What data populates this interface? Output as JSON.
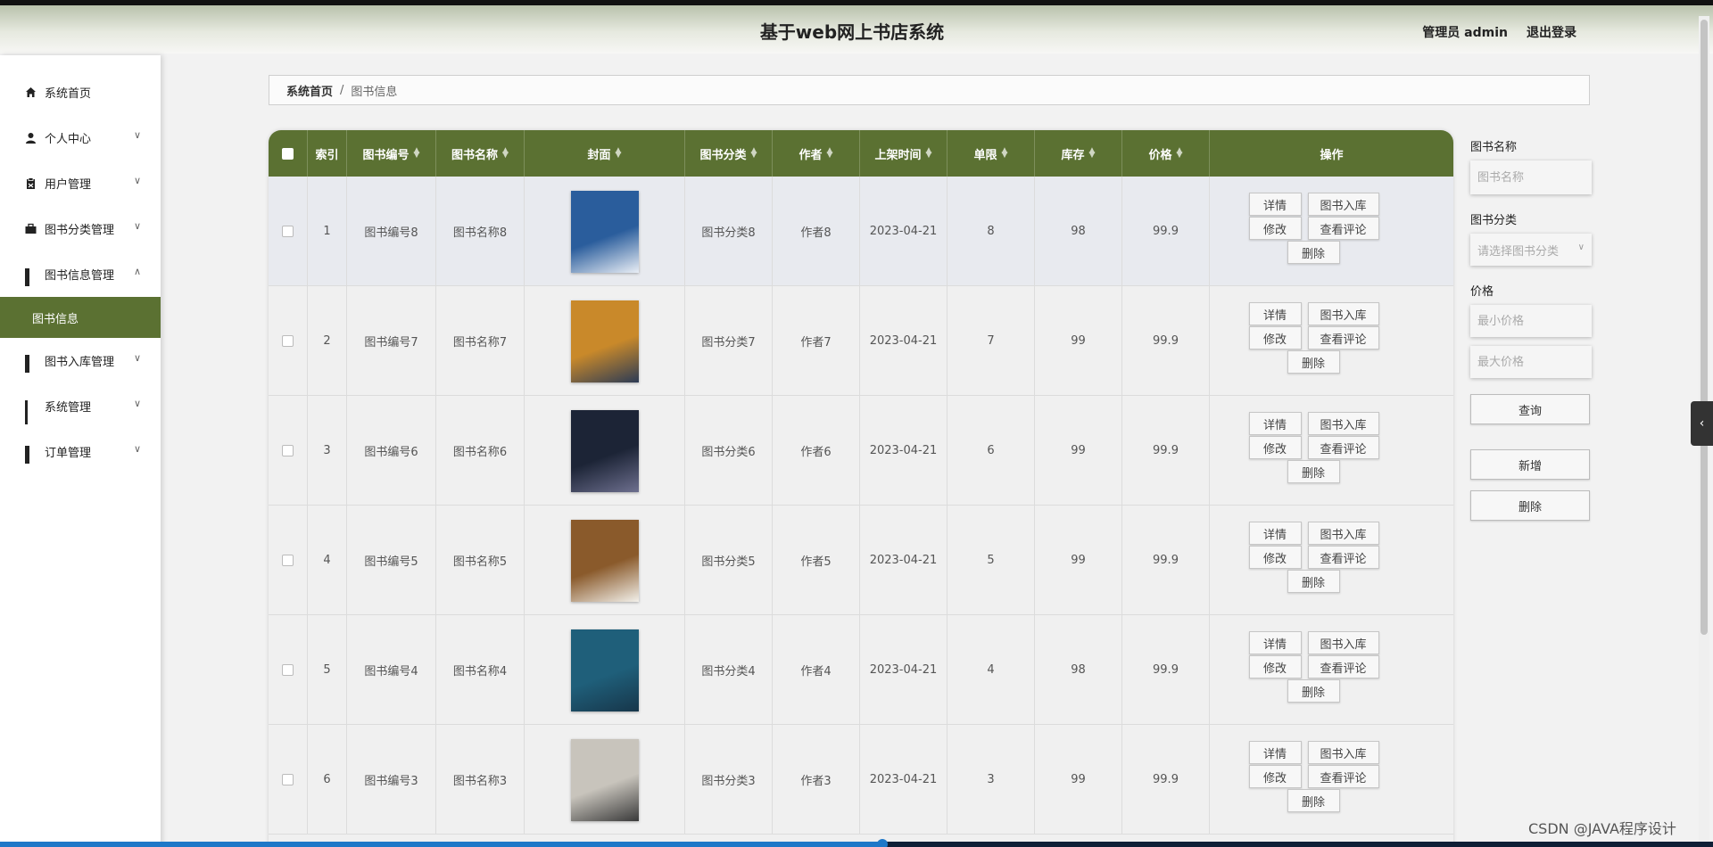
{
  "header": {
    "title": "基于web网上书店系统",
    "user_label": "管理员 admin",
    "logout_label": "退出登录"
  },
  "sidebar": {
    "items": [
      {
        "label": "系统首页",
        "icon": "home-icon"
      },
      {
        "label": "个人中心",
        "icon": "user-icon"
      },
      {
        "label": "用户管理",
        "icon": "clipboard-icon"
      },
      {
        "label": "图书分类管理",
        "icon": "briefcase-icon"
      },
      {
        "label": "图书信息管理",
        "icon": "grid-icon"
      },
      {
        "label": "图书入库管理",
        "icon": "grid-icon"
      },
      {
        "label": "系统管理",
        "icon": "grid9-icon"
      },
      {
        "label": "订单管理",
        "icon": "grid-icon"
      }
    ],
    "active_sub": "图书信息"
  },
  "breadcrumb": {
    "home": "系统首页",
    "separator": "/",
    "current": "图书信息"
  },
  "table": {
    "columns": [
      "索引",
      "图书编号",
      "图书名称",
      "封面",
      "图书分类",
      "作者",
      "上架时间",
      "单限",
      "库存",
      "价格",
      "操作"
    ],
    "rows": [
      {
        "index": "1",
        "code": "图书编号8",
        "name": "图书名称8",
        "category": "图书分类8",
        "author": "作者8",
        "date": "2023-04-21",
        "limit": "8",
        "stock": "98",
        "price": "99.9",
        "cover_colors": [
          "#2a5d9c",
          "#e9eef5"
        ]
      },
      {
        "index": "2",
        "code": "图书编号7",
        "name": "图书名称7",
        "category": "图书分类7",
        "author": "作者7",
        "date": "2023-04-21",
        "limit": "7",
        "stock": "99",
        "price": "99.9",
        "cover_colors": [
          "#c9892a",
          "#2c3b55"
        ]
      },
      {
        "index": "3",
        "code": "图书编号6",
        "name": "图书名称6",
        "category": "图书分类6",
        "author": "作者6",
        "date": "2023-04-21",
        "limit": "6",
        "stock": "99",
        "price": "99.9",
        "cover_colors": [
          "#1c2436",
          "#6d6f8e"
        ]
      },
      {
        "index": "4",
        "code": "图书编号5",
        "name": "图书名称5",
        "category": "图书分类5",
        "author": "作者5",
        "date": "2023-04-21",
        "limit": "5",
        "stock": "99",
        "price": "99.9",
        "cover_colors": [
          "#8a5a2b",
          "#f2f0ea"
        ]
      },
      {
        "index": "5",
        "code": "图书编号4",
        "name": "图书名称4",
        "category": "图书分类4",
        "author": "作者4",
        "date": "2023-04-21",
        "limit": "4",
        "stock": "98",
        "price": "99.9",
        "cover_colors": [
          "#1f5f7a",
          "#17364a"
        ]
      },
      {
        "index": "6",
        "code": "图书编号3",
        "name": "图书名称3",
        "category": "图书分类3",
        "author": "作者3",
        "date": "2023-04-21",
        "limit": "3",
        "stock": "99",
        "price": "99.9",
        "cover_colors": [
          "#c8c4bc",
          "#3a3a3a"
        ]
      }
    ],
    "actions": {
      "detail": "详情",
      "stock_in": "图书入库",
      "edit": "修改",
      "reviews": "查看评论",
      "delete": "删除"
    }
  },
  "search": {
    "name_label": "图书名称",
    "name_placeholder": "图书名称",
    "category_label": "图书分类",
    "category_placeholder": "请选择图书分类",
    "price_label": "价格",
    "min_placeholder": "最小价格",
    "max_placeholder": "最大价格",
    "query_label": "查询",
    "add_label": "新增",
    "delete_label": "删除"
  },
  "watermark": "CSDN @JAVA程序设计",
  "theme": {
    "accent": "#5b7132"
  }
}
